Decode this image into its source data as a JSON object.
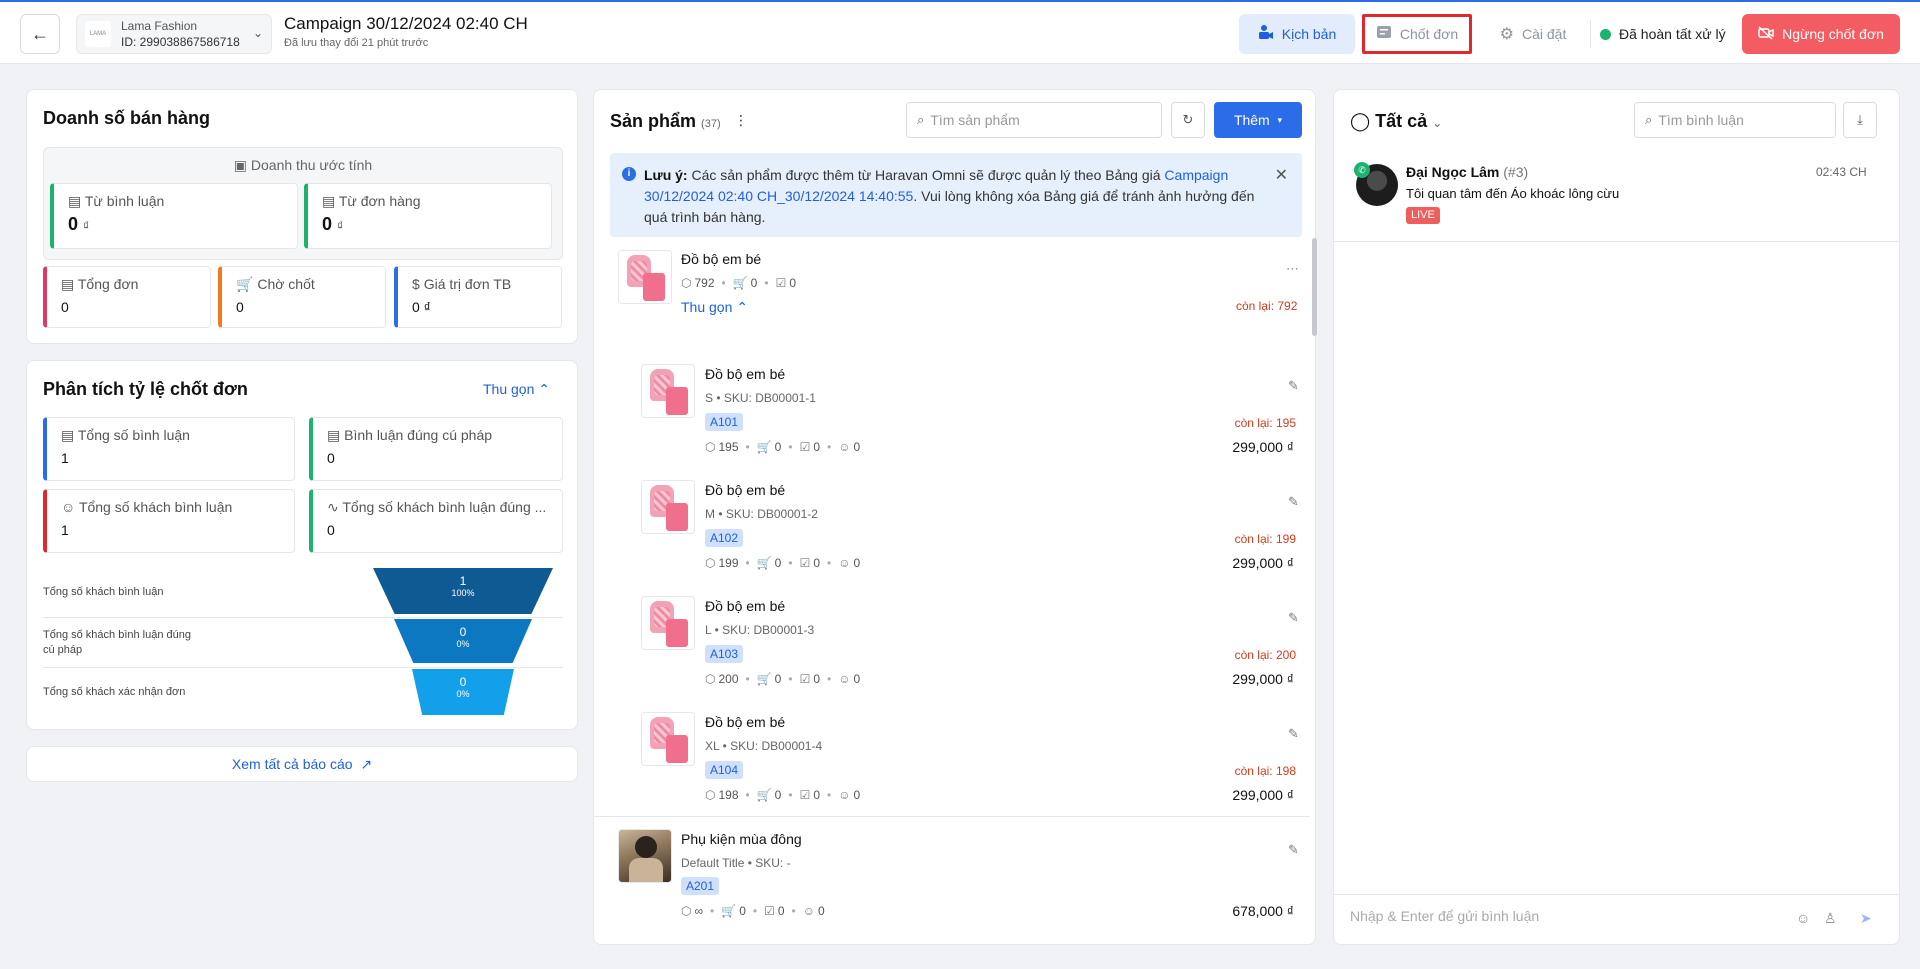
{
  "header": {
    "back_icon": "arrow-left-icon",
    "store": {
      "logo": "LAMA",
      "name": "Lama Fashion",
      "id": "ID: 299038867586718"
    },
    "campaign_title": "Campaign 30/12/2024 02:40 CH",
    "campaign_subtitle": "Đã lưu thay đổi 21 phút trước",
    "tabs": [
      {
        "label": "Kịch bản",
        "icon": "camera-icon"
      },
      {
        "label": "Chốt đơn",
        "icon": "checklist-icon"
      },
      {
        "label": "Cài đặt",
        "icon": "gear-icon"
      }
    ],
    "status": "Đã hoàn tất xử lý",
    "stop_button": "Ngừng chốt đơn",
    "colors": {
      "accent": "#2b6de8",
      "stop": "#f25c62",
      "status": "#1bb36d",
      "highlight_border": "#e0282e"
    }
  },
  "sales": {
    "title": "Doanh số bán hàng",
    "estimate_label": "Doanh thu ước tính",
    "from_comment": {
      "label": "Từ bình luận",
      "value": "0",
      "unit": "₫"
    },
    "from_order": {
      "label": "Từ đơn hàng",
      "value": "0",
      "unit": "₫"
    },
    "total_orders": {
      "label": "Tổng đơn",
      "value": "0"
    },
    "pending": {
      "label": "Chờ chốt",
      "value": "0"
    },
    "avg_value": {
      "label": "Giá trị đơn TB",
      "value": "0 ₫"
    }
  },
  "analysis": {
    "title": "Phân tích tỷ lệ chốt đơn",
    "collapse": "Thu gọn",
    "metrics": [
      {
        "label": "Tổng số bình luận",
        "value": "1"
      },
      {
        "label": "Bình luận đúng cú pháp",
        "value": "0"
      },
      {
        "label": "Tổng số khách bình luận",
        "value": "1"
      },
      {
        "label": "Tổng số khách bình luận đúng ...",
        "value": "0"
      }
    ],
    "funnel": [
      {
        "label": "Tổng số khách bình luận",
        "value": "1",
        "percent": "100%"
      },
      {
        "label": "Tổng số khách bình luận đúng cú pháp",
        "value": "0",
        "percent": "0%"
      },
      {
        "label": "Tổng số khách xác nhận đơn",
        "value": "0",
        "percent": "0%"
      }
    ]
  },
  "report_link": "Xem tất cả báo cáo",
  "products": {
    "title": "Sản phẩm",
    "count": "(37)",
    "search_placeholder": "Tìm sản phẩm",
    "add_button": "Thêm",
    "notice_label": "Lưu ý:",
    "notice_text": "Các sản phẩm được thêm từ Haravan Omni sẽ được quản lý theo Bảng giá",
    "notice_link": "Campaign 30/12/2024 02:40 CH_30/12/2024 14:40:55",
    "notice_text2": ". Vui lòng không xóa Bảng giá để tránh ảnh hưởng đến quá trình bán hàng.",
    "group": {
      "name": "Đồ bộ em bé",
      "stock": "792",
      "cart": "0",
      "confirmed": "0",
      "collapse": "Thu gọn",
      "remaining": "còn lại: 792"
    },
    "variants": [
      {
        "name": "Đồ bộ em bé",
        "meta": "S • SKU: DB00001-1",
        "tag": "A101",
        "remaining": "còn lại: 195",
        "stock": "195",
        "cart": "0",
        "confirmed": "0",
        "customers": "0",
        "price": "299,000 ₫"
      },
      {
        "name": "Đồ bộ em bé",
        "meta": "M • SKU: DB00001-2",
        "tag": "A102",
        "remaining": "còn lại: 199",
        "stock": "199",
        "cart": "0",
        "confirmed": "0",
        "customers": "0",
        "price": "299,000 ₫"
      },
      {
        "name": "Đồ bộ em bé",
        "meta": "L • SKU: DB00001-3",
        "tag": "A103",
        "remaining": "còn lại: 200",
        "stock": "200",
        "cart": "0",
        "confirmed": "0",
        "customers": "0",
        "price": "299,000 ₫"
      },
      {
        "name": "Đồ bộ em bé",
        "meta": "XL • SKU: DB00001-4",
        "tag": "A104",
        "remaining": "còn lại: 198",
        "stock": "198",
        "cart": "0",
        "confirmed": "0",
        "customers": "0",
        "price": "299,000 ₫"
      }
    ],
    "accessory": {
      "name": "Phụ kiện mùa đông",
      "meta": "Default Title • SKU: -",
      "tag": "A201",
      "stock": "∞",
      "cart": "0",
      "confirmed": "0",
      "customers": "0",
      "price": "678,000 ₫"
    }
  },
  "comments": {
    "filter": "Tất cả",
    "search_placeholder": "Tìm bình luận",
    "items": [
      {
        "name": "Đại Ngọc Lâm",
        "index": "(#3)",
        "time": "02:43 CH",
        "text": "Tôi quan tâm đến Áo khoác lông cừu",
        "badge": "LIVE"
      }
    ],
    "input_placeholder": "Nhập & Enter để gửi bình luận"
  }
}
